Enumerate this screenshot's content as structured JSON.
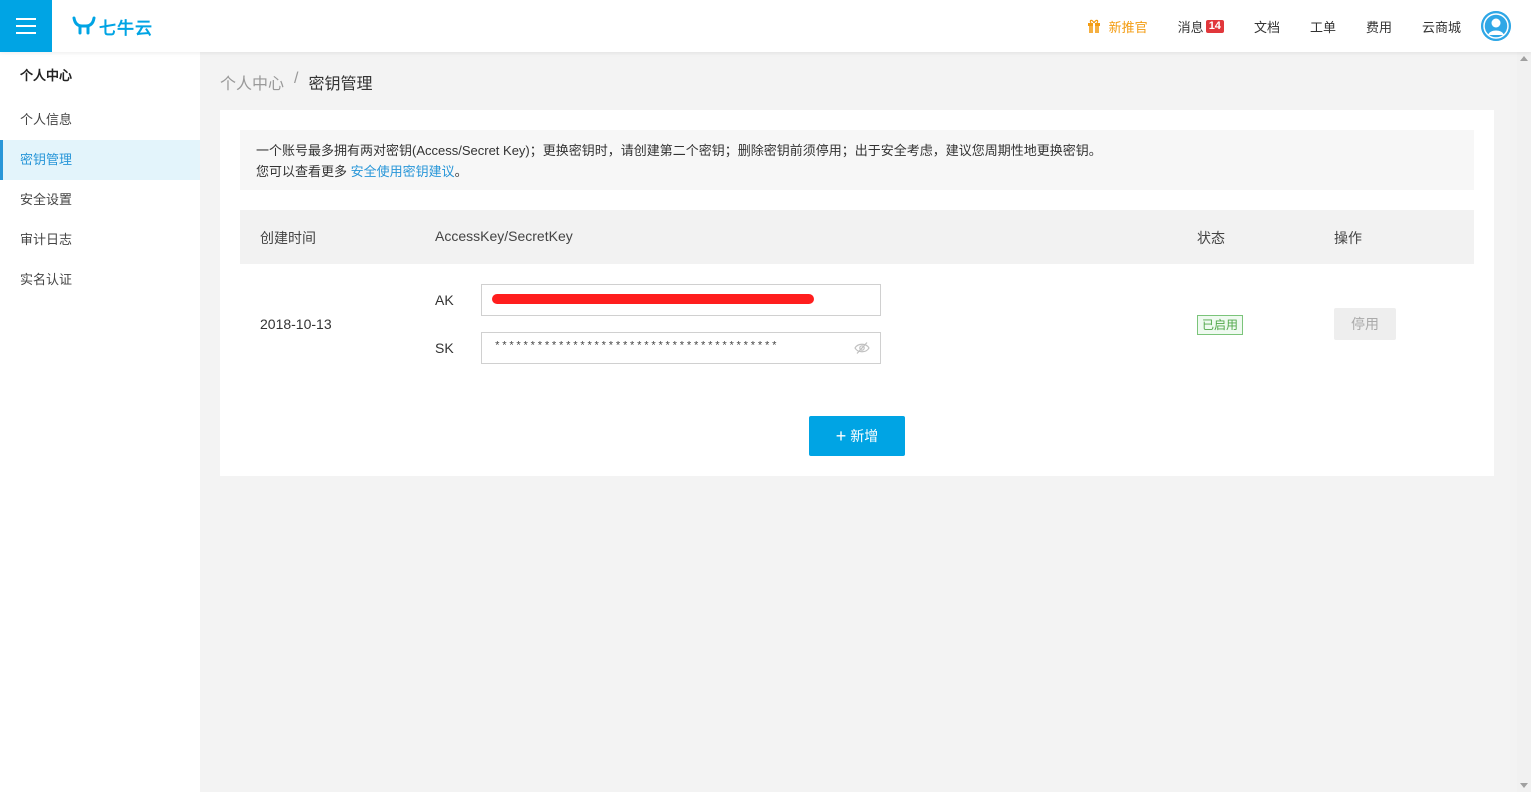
{
  "header": {
    "logo_text": "七牛云",
    "nav": {
      "promo": "新推官",
      "messages": "消息",
      "message_count": "14",
      "docs": "文档",
      "tickets": "工单",
      "billing": "费用",
      "store": "云商城"
    }
  },
  "sidebar": {
    "title": "个人中心",
    "items": [
      {
        "label": "个人信息"
      },
      {
        "label": "密钥管理"
      },
      {
        "label": "安全设置"
      },
      {
        "label": "审计日志"
      },
      {
        "label": "实名认证"
      }
    ]
  },
  "breadcrumb": {
    "parent": "个人中心",
    "separator": "/",
    "current": "密钥管理"
  },
  "notice": {
    "line1": "一个账号最多拥有两对密钥(Access/Secret Key)；更换密钥时，请创建第二个密钥；删除密钥前须停用；出于安全考虑，建议您周期性地更换密钥。",
    "line2_prefix": "您可以查看更多",
    "line2_link": "安全使用密钥建议",
    "line2_suffix": "。"
  },
  "table": {
    "headers": {
      "created": "创建时间",
      "keys": "AccessKey/SecretKey",
      "status": "状态",
      "actions": "操作"
    },
    "rows": [
      {
        "created": "2018-10-13",
        "ak_label": "AK",
        "sk_label": "SK",
        "sk_value": "****************************************",
        "status": "已启用",
        "action": "停用"
      }
    ]
  },
  "add_button": "新增",
  "colors": {
    "brand": "#00a4e4",
    "link": "#2896d8",
    "promo": "#f39c12",
    "badge": "#e1373b",
    "status_ok": "#52a84a",
    "redaction": "#ff1e1e"
  }
}
